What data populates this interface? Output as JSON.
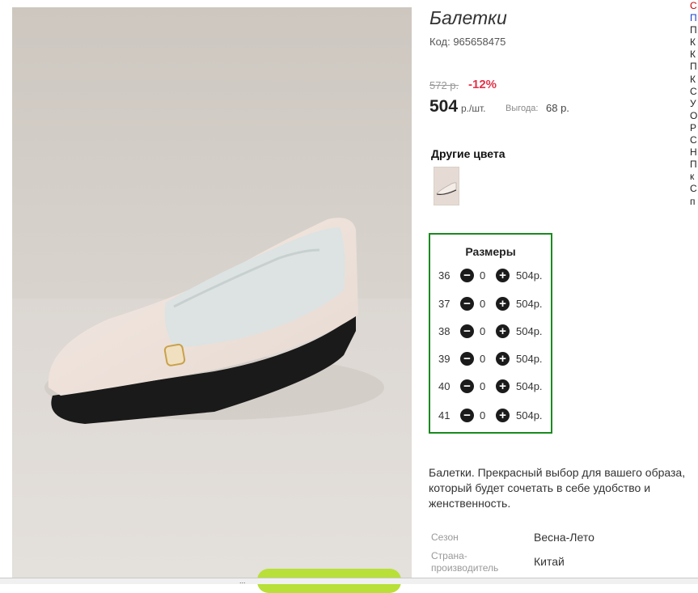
{
  "product": {
    "title": "Балетки",
    "code": "Код: 965658475",
    "old_price": "572 р.",
    "discount": "-12%",
    "price": "504",
    "price_unit": "р./шт.",
    "savings_label": "Выгода:",
    "savings_value": "68 р."
  },
  "colors": {
    "heading": "Другие цвета"
  },
  "sizes": {
    "heading": "Размеры",
    "minus_icon": "−",
    "plus_icon": "+",
    "rows": [
      {
        "size": "36",
        "qty": "0",
        "price": "504р."
      },
      {
        "size": "37",
        "qty": "0",
        "price": "504р."
      },
      {
        "size": "38",
        "qty": "0",
        "price": "504р."
      },
      {
        "size": "39",
        "qty": "0",
        "price": "504р."
      },
      {
        "size": "40",
        "qty": "0",
        "price": "504р."
      },
      {
        "size": "41",
        "qty": "0",
        "price": "504р."
      }
    ]
  },
  "description": "Балетки. Прекрасный выбор для вашего образа, который будет сочетать в себе удобство и женственность.",
  "specs": [
    {
      "label": "Сезон",
      "value": "Весна-Лето"
    },
    {
      "label": "Страна-производитель",
      "value": "Китай"
    }
  ],
  "right_column": [
    "С",
    "П",
    "П",
    "К",
    "К",
    "П",
    "К",
    "С",
    "У",
    "О",
    "Р",
    "С",
    "Н",
    "П",
    "к",
    "С",
    "п"
  ],
  "status_dots": "..."
}
